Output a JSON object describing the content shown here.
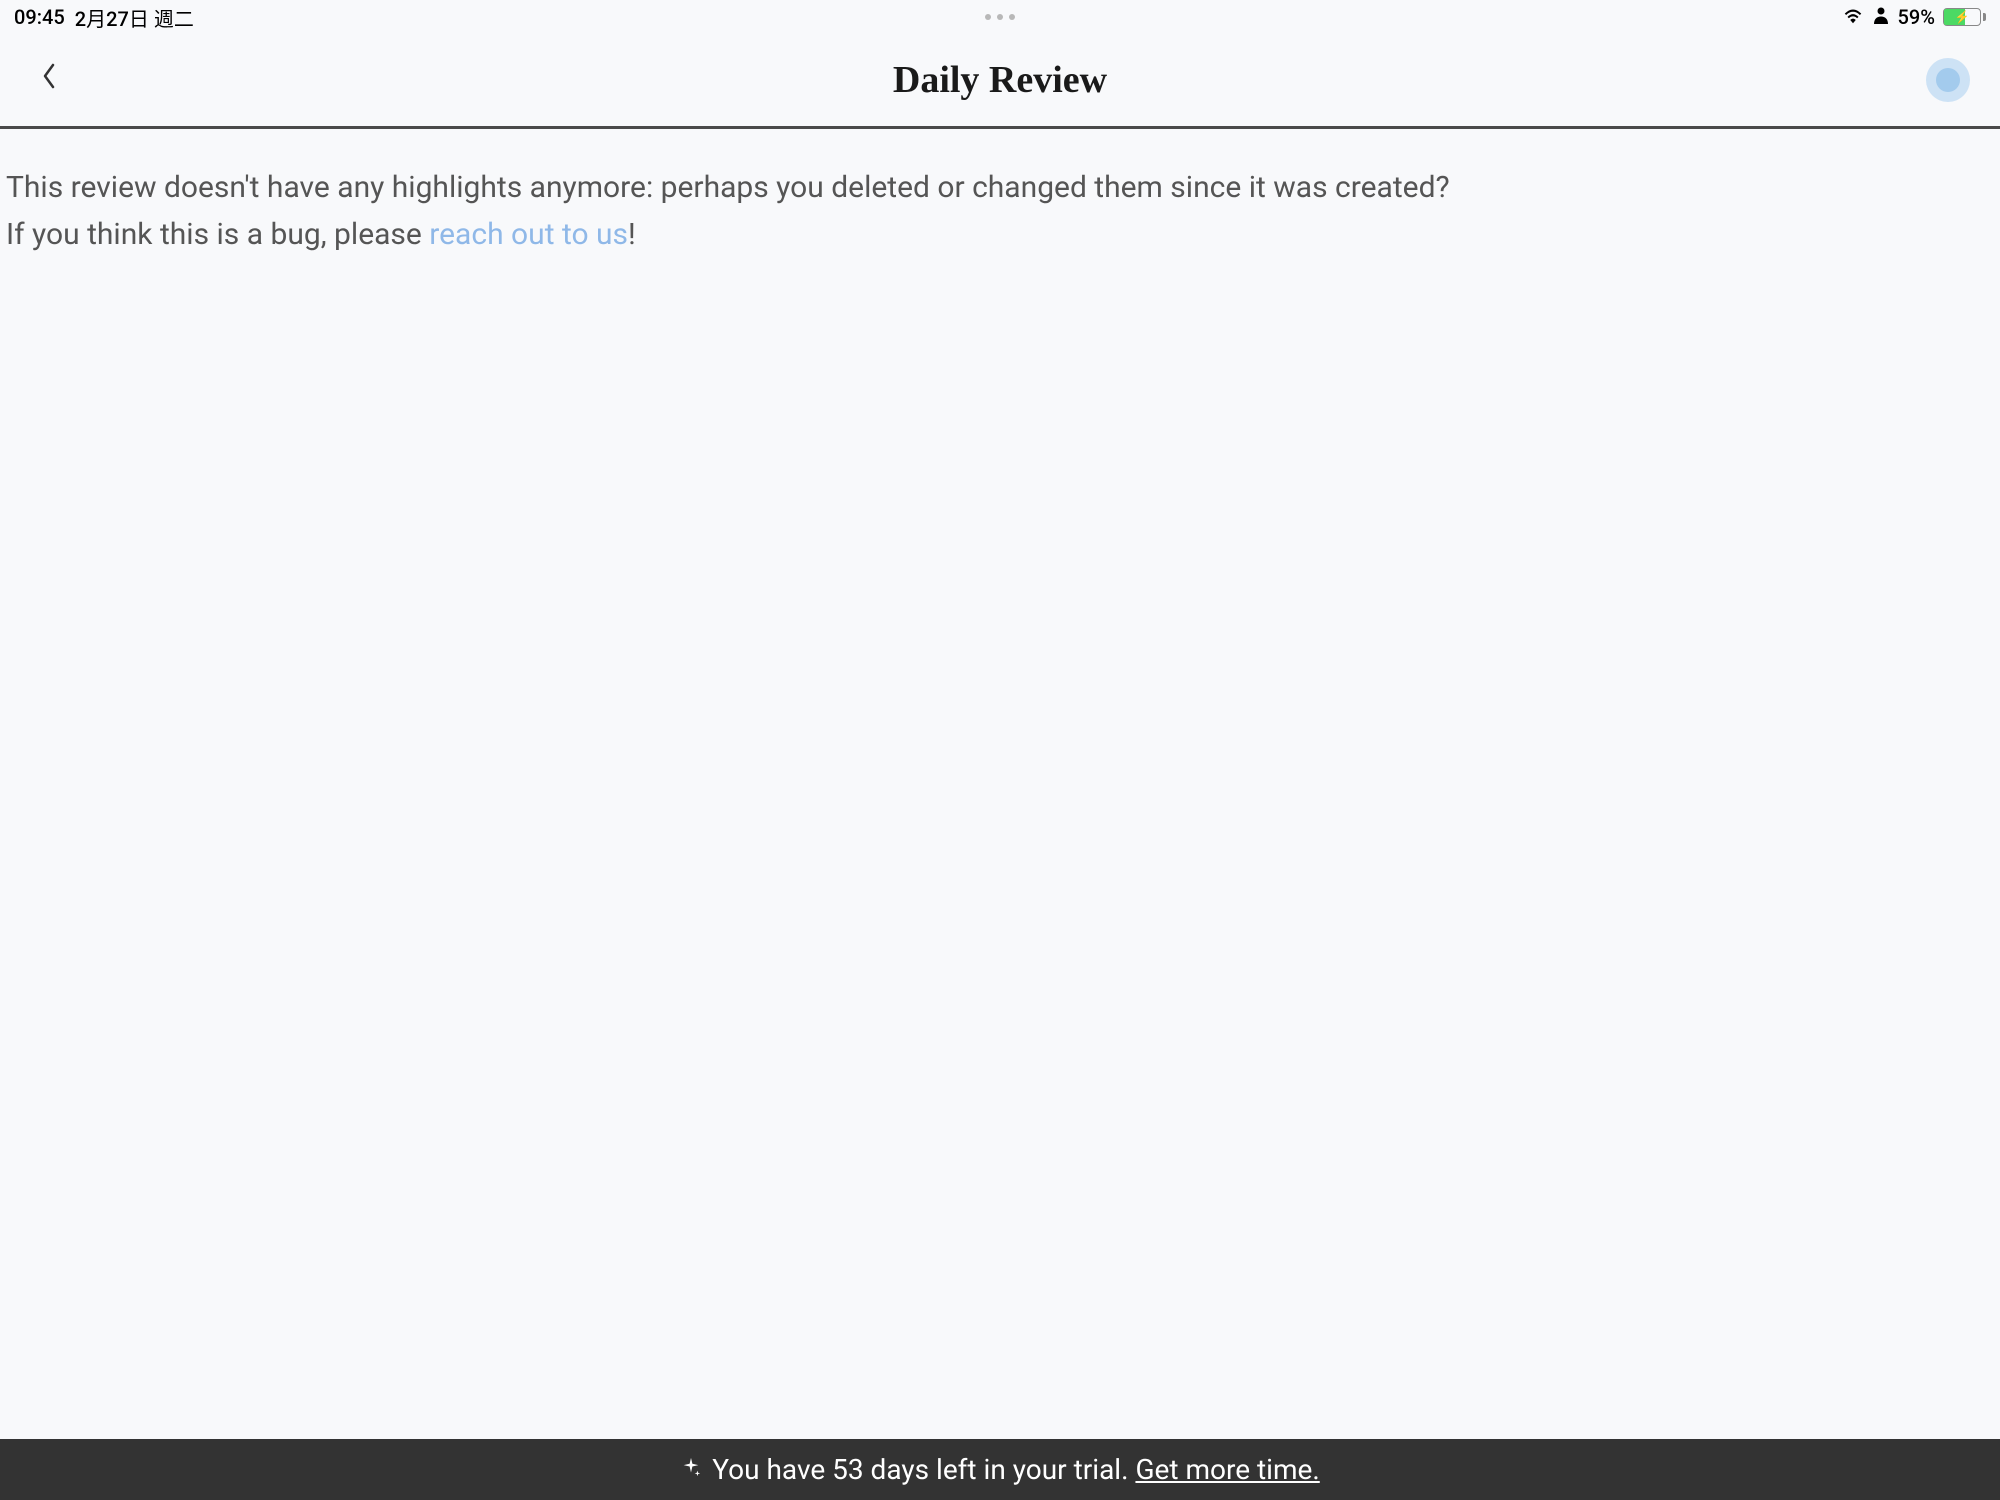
{
  "statusBar": {
    "time": "09:45",
    "date": "2月27日 週二",
    "batteryPercent": "59%"
  },
  "header": {
    "title": "Daily Review"
  },
  "content": {
    "line1": "This review doesn't have any highlights anymore: perhaps you deleted or changed them since it was created?",
    "line2a": "If you think this is a bug, please ",
    "link": "reach out to us",
    "line2b": "!"
  },
  "bottomBar": {
    "textA": "You have 53 days left in your trial. ",
    "linkText": "Get more time."
  }
}
